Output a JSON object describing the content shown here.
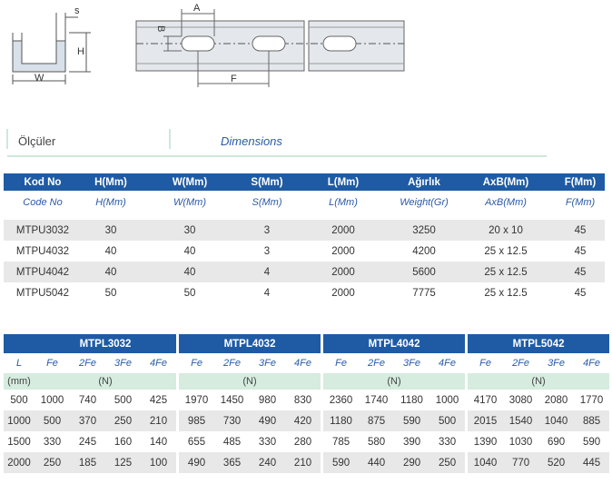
{
  "diagram": {
    "labels": {
      "s": "s",
      "h": "H",
      "w": "W",
      "a": "A",
      "b": "B",
      "f": "F"
    }
  },
  "section": {
    "title_tr": "Ölçüler",
    "title_en": "Dimensions"
  },
  "dimensions": {
    "headers": [
      "Kod No",
      "H(Mm)",
      "W(Mm)",
      "S(Mm)",
      "L(Mm)",
      "Ağırlık",
      "AxB(Mm)",
      "F(Mm)"
    ],
    "subheaders": [
      "Code No",
      "H(Mm)",
      "W(Mm)",
      "S(Mm)",
      "L(Mm)",
      "Weight(Gr)",
      "AxB(Mm)",
      "F(Mm)"
    ],
    "rows": [
      [
        "MTPU3032",
        "30",
        "30",
        "3",
        "2000",
        "3250",
        "20 x 10",
        "45"
      ],
      [
        "MTPU4032",
        "40",
        "40",
        "3",
        "2000",
        "4200",
        "25 x 12.5",
        "45"
      ],
      [
        "MTPU4042",
        "40",
        "40",
        "4",
        "2000",
        "5600",
        "25 x 12.5",
        "45"
      ],
      [
        "MTPU5042",
        "50",
        "50",
        "4",
        "2000",
        "7775",
        "25 x 12.5",
        "45"
      ]
    ]
  },
  "loads": {
    "groups": [
      "MTPL3032",
      "MTPL4032",
      "MTPL4042",
      "MTPL5042"
    ],
    "l_label": "L",
    "unit_mm": "(mm)",
    "unit_n": "(N)",
    "subcols": [
      "Fe",
      "2Fe",
      "3Fe",
      "4Fe"
    ],
    "rows": [
      {
        "l": "500",
        "values": [
          "1000",
          "740",
          "500",
          "425",
          "1970",
          "1450",
          "980",
          "830",
          "2360",
          "1740",
          "1180",
          "1000",
          "4170",
          "3080",
          "2080",
          "1770"
        ]
      },
      {
        "l": "1000",
        "values": [
          "500",
          "370",
          "250",
          "210",
          "985",
          "730",
          "490",
          "420",
          "1180",
          "875",
          "590",
          "500",
          "2015",
          "1540",
          "1040",
          "885"
        ]
      },
      {
        "l": "1500",
        "values": [
          "330",
          "245",
          "160",
          "140",
          "655",
          "485",
          "330",
          "280",
          "785",
          "580",
          "390",
          "330",
          "1390",
          "1030",
          "690",
          "590"
        ]
      },
      {
        "l": "2000",
        "values": [
          "250",
          "185",
          "125",
          "100",
          "490",
          "365",
          "240",
          "210",
          "590",
          "440",
          "290",
          "250",
          "1040",
          "770",
          "520",
          "445"
        ]
      }
    ]
  }
}
